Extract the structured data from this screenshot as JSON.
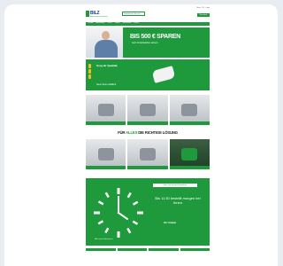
{
  "header": {
    "logo_text": "BILZ",
    "logo_sub": "Ausrüstung für Präzision",
    "center_button": "Kontaktieren Sie uns",
    "util_links": "Menu · DE · Login",
    "cart_label": "Warenkorb"
  },
  "nav": [
    "Produkte",
    "Anwendungen",
    "Service",
    "Karriere",
    "Unternehmen",
    "Kontakt"
  ],
  "hero": {
    "title": "BIS 500 € SPAREN",
    "subtitle": "Jetzt Vorteilsaktion sichern"
  },
  "promo": {
    "title": "Sorg dir Qualität",
    "tag": "Neue Serie erhältlich"
  },
  "solution_line": {
    "prefix": "FÜR ",
    "accent": "ALLES",
    "suffix": " DIE RICHTIGE LÖSUNG"
  },
  "clock_banner": {
    "title": "Mehr Zeit für das Wesentliche",
    "body": "Bis 11:30 bestellt morgen bei Ihnen",
    "foot": "Ihr Urlaub",
    "note": "Mehr zum Lieferservice"
  },
  "colors": {
    "brand_green": "#1e9a3c",
    "logo_blue": "#1a3d8f"
  }
}
